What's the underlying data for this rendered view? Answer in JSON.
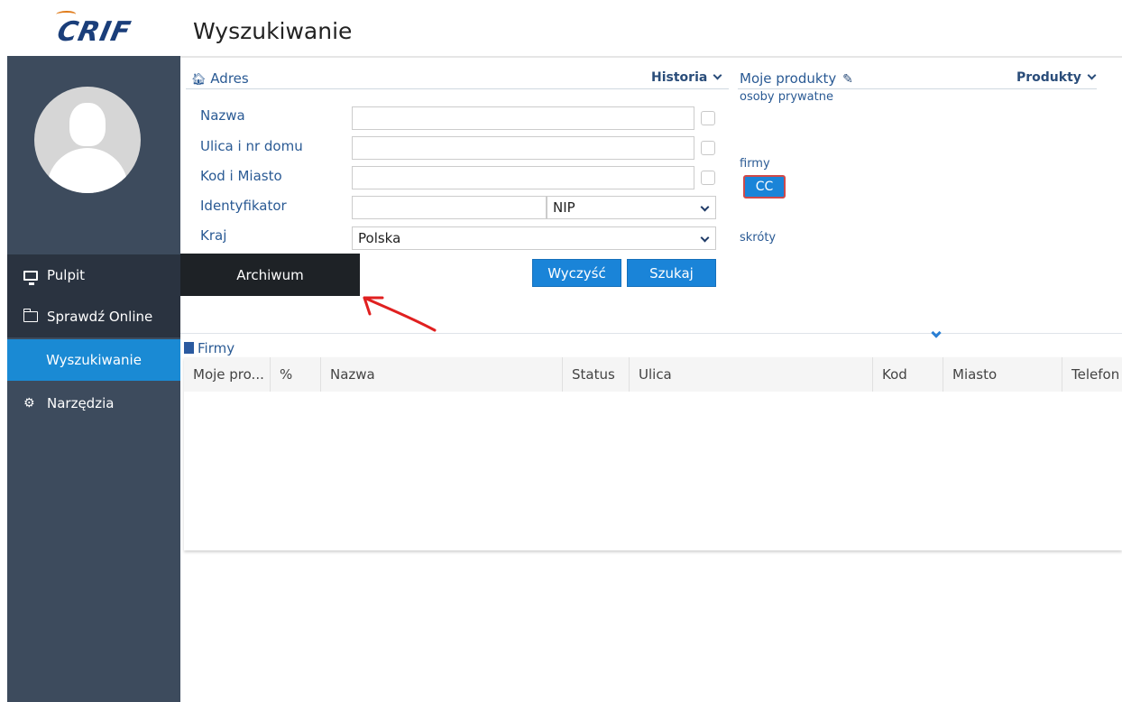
{
  "app": {
    "logo_text": "CRIF"
  },
  "header": {
    "title": "Wyszukiwanie"
  },
  "sidebar": {
    "items": [
      {
        "label": "Pulpit",
        "icon": "monitor-icon"
      },
      {
        "label": "Sprawdź Online",
        "icon": "folder-icon"
      },
      {
        "label": "Wyszukiwanie",
        "active": true
      },
      {
        "label": "Narzędzia",
        "icon": "cogs-icon"
      }
    ],
    "popup_label": "Archiwum"
  },
  "search": {
    "section_title": "Adres",
    "history_label": "Historia",
    "fields": [
      {
        "label": "Nazwa",
        "value": ""
      },
      {
        "label": "Ulica i nr domu",
        "value": ""
      },
      {
        "label": "Kod i Miasto",
        "value": ""
      },
      {
        "label": "Identyfikator",
        "value": "",
        "type_value": "NIP"
      },
      {
        "label": "Kraj",
        "value": "Polska"
      }
    ],
    "clear_label": "Wyczyść",
    "search_label": "Szukaj"
  },
  "products": {
    "title": "Moje produkty",
    "dropdown_label": "Produkty",
    "group_private": "osoby prywatne",
    "group_companies": "firmy",
    "company_product": "CC",
    "group_shortcuts": "skróty"
  },
  "results": {
    "title": "Firmy",
    "columns": [
      "Moje pro...",
      "%",
      "Nazwa",
      "Status",
      "Ulica",
      "Kod",
      "Miasto",
      "Telefon"
    ]
  },
  "colors": {
    "sidebar": "#3d4b5d",
    "sidebar_dark": "#2a3340",
    "accent": "#1a84d8",
    "annotation_arrow": "#e02020"
  }
}
